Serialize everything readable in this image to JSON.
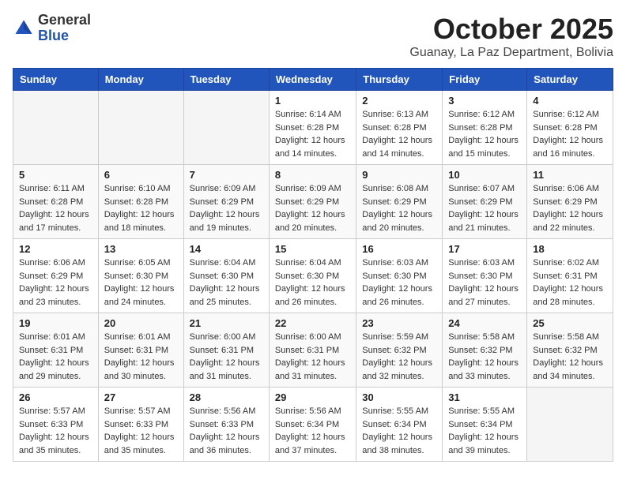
{
  "header": {
    "logo_general": "General",
    "logo_blue": "Blue",
    "month_title": "October 2025",
    "location": "Guanay, La Paz Department, Bolivia"
  },
  "days_of_week": [
    "Sunday",
    "Monday",
    "Tuesday",
    "Wednesday",
    "Thursday",
    "Friday",
    "Saturday"
  ],
  "weeks": [
    [
      {
        "day": "",
        "sunrise": "",
        "sunset": "",
        "daylight": ""
      },
      {
        "day": "",
        "sunrise": "",
        "sunset": "",
        "daylight": ""
      },
      {
        "day": "",
        "sunrise": "",
        "sunset": "",
        "daylight": ""
      },
      {
        "day": "1",
        "sunrise": "6:14 AM",
        "sunset": "6:28 PM",
        "daylight": "12 hours and 14 minutes."
      },
      {
        "day": "2",
        "sunrise": "6:13 AM",
        "sunset": "6:28 PM",
        "daylight": "12 hours and 14 minutes."
      },
      {
        "day": "3",
        "sunrise": "6:12 AM",
        "sunset": "6:28 PM",
        "daylight": "12 hours and 15 minutes."
      },
      {
        "day": "4",
        "sunrise": "6:12 AM",
        "sunset": "6:28 PM",
        "daylight": "12 hours and 16 minutes."
      }
    ],
    [
      {
        "day": "5",
        "sunrise": "6:11 AM",
        "sunset": "6:28 PM",
        "daylight": "12 hours and 17 minutes."
      },
      {
        "day": "6",
        "sunrise": "6:10 AM",
        "sunset": "6:28 PM",
        "daylight": "12 hours and 18 minutes."
      },
      {
        "day": "7",
        "sunrise": "6:09 AM",
        "sunset": "6:29 PM",
        "daylight": "12 hours and 19 minutes."
      },
      {
        "day": "8",
        "sunrise": "6:09 AM",
        "sunset": "6:29 PM",
        "daylight": "12 hours and 20 minutes."
      },
      {
        "day": "9",
        "sunrise": "6:08 AM",
        "sunset": "6:29 PM",
        "daylight": "12 hours and 20 minutes."
      },
      {
        "day": "10",
        "sunrise": "6:07 AM",
        "sunset": "6:29 PM",
        "daylight": "12 hours and 21 minutes."
      },
      {
        "day": "11",
        "sunrise": "6:06 AM",
        "sunset": "6:29 PM",
        "daylight": "12 hours and 22 minutes."
      }
    ],
    [
      {
        "day": "12",
        "sunrise": "6:06 AM",
        "sunset": "6:29 PM",
        "daylight": "12 hours and 23 minutes."
      },
      {
        "day": "13",
        "sunrise": "6:05 AM",
        "sunset": "6:30 PM",
        "daylight": "12 hours and 24 minutes."
      },
      {
        "day": "14",
        "sunrise": "6:04 AM",
        "sunset": "6:30 PM",
        "daylight": "12 hours and 25 minutes."
      },
      {
        "day": "15",
        "sunrise": "6:04 AM",
        "sunset": "6:30 PM",
        "daylight": "12 hours and 26 minutes."
      },
      {
        "day": "16",
        "sunrise": "6:03 AM",
        "sunset": "6:30 PM",
        "daylight": "12 hours and 26 minutes."
      },
      {
        "day": "17",
        "sunrise": "6:03 AM",
        "sunset": "6:30 PM",
        "daylight": "12 hours and 27 minutes."
      },
      {
        "day": "18",
        "sunrise": "6:02 AM",
        "sunset": "6:31 PM",
        "daylight": "12 hours and 28 minutes."
      }
    ],
    [
      {
        "day": "19",
        "sunrise": "6:01 AM",
        "sunset": "6:31 PM",
        "daylight": "12 hours and 29 minutes."
      },
      {
        "day": "20",
        "sunrise": "6:01 AM",
        "sunset": "6:31 PM",
        "daylight": "12 hours and 30 minutes."
      },
      {
        "day": "21",
        "sunrise": "6:00 AM",
        "sunset": "6:31 PM",
        "daylight": "12 hours and 31 minutes."
      },
      {
        "day": "22",
        "sunrise": "6:00 AM",
        "sunset": "6:31 PM",
        "daylight": "12 hours and 31 minutes."
      },
      {
        "day": "23",
        "sunrise": "5:59 AM",
        "sunset": "6:32 PM",
        "daylight": "12 hours and 32 minutes."
      },
      {
        "day": "24",
        "sunrise": "5:58 AM",
        "sunset": "6:32 PM",
        "daylight": "12 hours and 33 minutes."
      },
      {
        "day": "25",
        "sunrise": "5:58 AM",
        "sunset": "6:32 PM",
        "daylight": "12 hours and 34 minutes."
      }
    ],
    [
      {
        "day": "26",
        "sunrise": "5:57 AM",
        "sunset": "6:33 PM",
        "daylight": "12 hours and 35 minutes."
      },
      {
        "day": "27",
        "sunrise": "5:57 AM",
        "sunset": "6:33 PM",
        "daylight": "12 hours and 35 minutes."
      },
      {
        "day": "28",
        "sunrise": "5:56 AM",
        "sunset": "6:33 PM",
        "daylight": "12 hours and 36 minutes."
      },
      {
        "day": "29",
        "sunrise": "5:56 AM",
        "sunset": "6:34 PM",
        "daylight": "12 hours and 37 minutes."
      },
      {
        "day": "30",
        "sunrise": "5:55 AM",
        "sunset": "6:34 PM",
        "daylight": "12 hours and 38 minutes."
      },
      {
        "day": "31",
        "sunrise": "5:55 AM",
        "sunset": "6:34 PM",
        "daylight": "12 hours and 39 minutes."
      },
      {
        "day": "",
        "sunrise": "",
        "sunset": "",
        "daylight": ""
      }
    ]
  ]
}
